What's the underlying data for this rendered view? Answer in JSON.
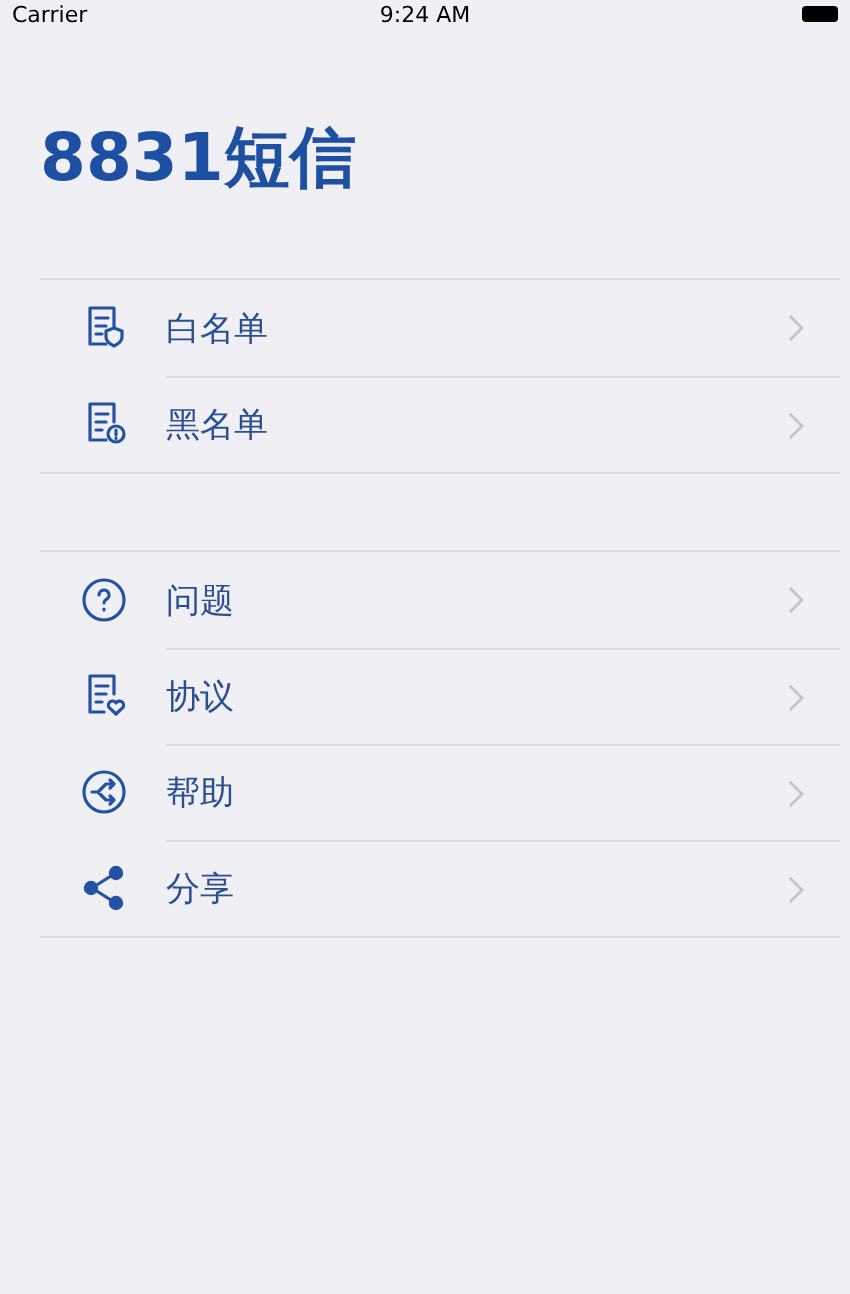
{
  "status_bar": {
    "carrier": "Carrier",
    "time": "9:24 AM"
  },
  "title": "8831短信",
  "groups": [
    {
      "items": [
        {
          "kind": "whitelist",
          "label": "白名单"
        },
        {
          "kind": "blacklist",
          "label": "黑名单"
        }
      ]
    },
    {
      "items": [
        {
          "kind": "question",
          "label": "问题"
        },
        {
          "kind": "agreement",
          "label": "协议"
        },
        {
          "kind": "help",
          "label": "帮助"
        },
        {
          "kind": "share",
          "label": "分享"
        }
      ]
    }
  ]
}
